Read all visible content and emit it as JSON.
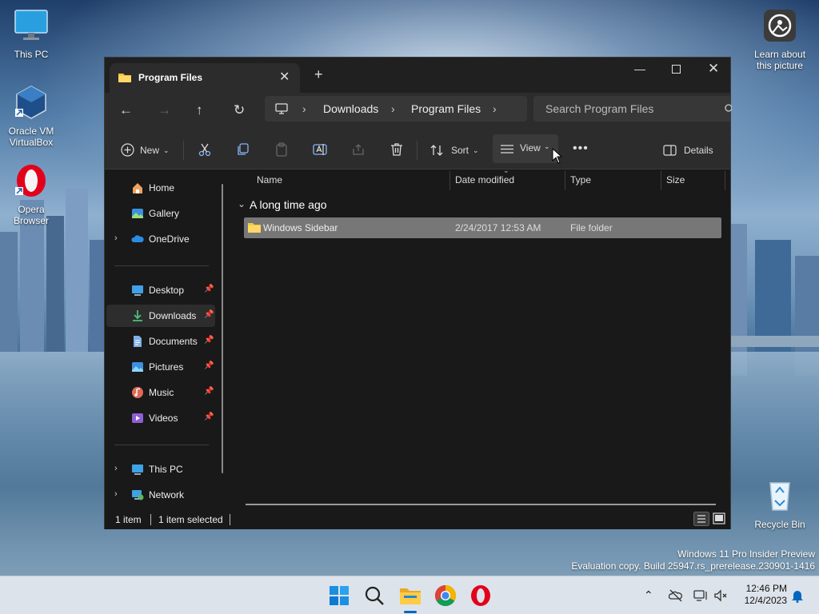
{
  "desktop": {
    "icons": [
      {
        "label": "This PC"
      },
      {
        "label": "Oracle VM VirtualBox"
      },
      {
        "label": "Opera Browser"
      },
      {
        "label": "Learn about this picture"
      },
      {
        "label": "Recycle Bin"
      }
    ],
    "watermark": {
      "line1": "Windows 11 Pro Insider Preview",
      "line2": "Evaluation copy. Build 25947.rs_prerelease.230901-1416"
    }
  },
  "window": {
    "tab": {
      "title": "Program Files"
    },
    "address": {
      "crumbs": [
        "Downloads",
        "Program Files"
      ]
    },
    "search": {
      "placeholder": "Search Program Files"
    },
    "toolbar": {
      "new_label": "New",
      "sort_label": "Sort",
      "view_label": "View",
      "details_label": "Details"
    },
    "sidebar": {
      "items": [
        {
          "label": "Home"
        },
        {
          "label": "Gallery"
        },
        {
          "label": "OneDrive"
        },
        {
          "label": "Desktop"
        },
        {
          "label": "Downloads"
        },
        {
          "label": "Documents"
        },
        {
          "label": "Pictures"
        },
        {
          "label": "Music"
        },
        {
          "label": "Videos"
        },
        {
          "label": "This PC"
        },
        {
          "label": "Network"
        }
      ]
    },
    "columns": [
      "Name",
      "Date modified",
      "Type",
      "Size"
    ],
    "group": {
      "title": "A long time ago"
    },
    "rows": [
      {
        "name": "Windows Sidebar",
        "date": "2/24/2017 12:53 AM",
        "type": "File folder",
        "size": ""
      }
    ],
    "status": {
      "count": "1 item",
      "selected": "1 item selected"
    }
  },
  "taskbar": {
    "clock": {
      "time": "12:46 PM",
      "date": "12/4/2023"
    }
  },
  "colors": {
    "accent": "#0067c0",
    "window_bg": "#191919",
    "selection": "#777777"
  }
}
